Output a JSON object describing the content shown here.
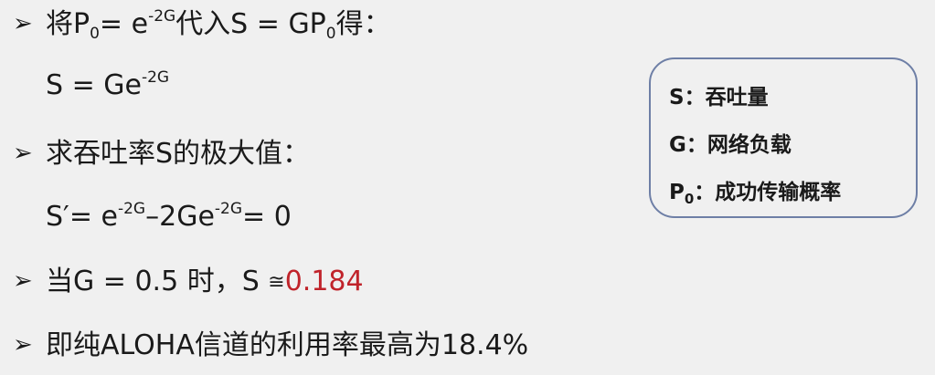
{
  "lines": [
    {
      "arrow": "➢",
      "a": "将P",
      "a_sub": "0",
      "b": "= e",
      "b_sup": "-2G",
      "c": "代入S = GP",
      "c_sub": "0",
      "d": "得："
    },
    {
      "a": "S = Ge",
      "a_sup": "-2G"
    },
    {
      "arrow": "➢",
      "a": "求吞吐率S的极大值："
    },
    {
      "a": "S′= e",
      "a_sup": "-2G",
      "b": "–2Ge",
      "b_sup": "-2G",
      "c": "= 0"
    },
    {
      "arrow": "➢",
      "a": "当G = 0.5 时，S ",
      "approx": "≅",
      "value": "0.184"
    },
    {
      "arrow": "➢",
      "a": "即纯ALOHA信道的利用率最高为18.4%"
    }
  ],
  "legend": [
    {
      "sym": "S",
      "sep": "：",
      "text": "吞吐量"
    },
    {
      "sym": "G",
      "sep": "：",
      "text": "网络负载"
    },
    {
      "sym": "P",
      "sym_sub": "0",
      "sep": "：",
      "text": "成功传输概率"
    }
  ],
  "colors": {
    "highlight": "#c0232a",
    "legend_border": "#6e7fa6"
  }
}
